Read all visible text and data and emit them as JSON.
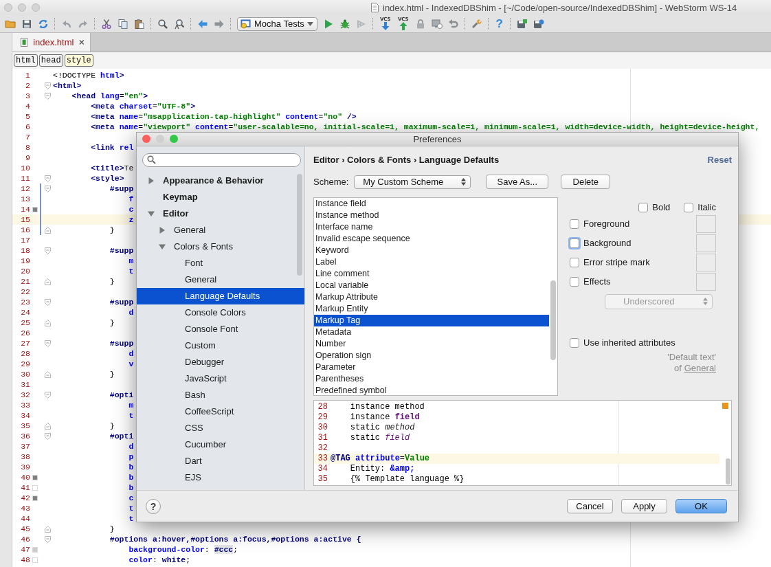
{
  "window": {
    "title": "index.html - IndexedDBShim - [~/Code/open-source/IndexedDBShim] - WebStorm WS-14"
  },
  "toolbar": {
    "run_configuration": "Mocha Tests",
    "vcs_update_label": "VCS",
    "vcs_commit_label": "VCS",
    "help_label": "?"
  },
  "tabs": [
    {
      "label": "index.html",
      "selected": true
    }
  ],
  "breadcrumbs": [
    {
      "label": "html",
      "selected": false
    },
    {
      "label": "head",
      "selected": false
    },
    {
      "label": "style",
      "selected": true
    }
  ],
  "editor": {
    "lines": [
      {
        "number": "1",
        "text": "<!DOCTYPE html>"
      },
      {
        "number": "2",
        "text": "<html>",
        "fold_start": true
      },
      {
        "number": "3",
        "text": "    <head lang=\"en\">",
        "fold_start": true
      },
      {
        "number": "4",
        "text": "        <meta charset=\"UTF-8\">"
      },
      {
        "number": "5",
        "text": "        <meta name=\"msapplication-tap-highlight\" content=\"no\" />"
      },
      {
        "number": "6",
        "text": "        <meta name=\"viewport\" content=\"user-scalable=no, initial-scale=1, maximum-scale=1, minimum-scale=1, width=device-width, height=device-height,"
      },
      {
        "number": "7"
      },
      {
        "number": "8",
        "text": "        <link rel"
      },
      {
        "number": "9"
      },
      {
        "number": "10",
        "text": "        <title>Te"
      },
      {
        "number": "11",
        "text": "        <style>",
        "fold_start": true
      },
      {
        "number": "12",
        "text": "            #supp",
        "fold_start": true,
        "changed": true
      },
      {
        "number": "13",
        "text": "                f",
        "changed": true
      },
      {
        "number": "14",
        "text": "                c",
        "changed": true,
        "color": "#808080"
      },
      {
        "number": "15",
        "text": "                z",
        "changed": true,
        "current": true
      },
      {
        "number": "16",
        "text": "            }",
        "fold_end": true,
        "changed": true
      },
      {
        "number": "17"
      },
      {
        "number": "18",
        "text": "            #supp",
        "fold_start": true
      },
      {
        "number": "19",
        "text": "                m"
      },
      {
        "number": "20",
        "text": "                t"
      },
      {
        "number": "21",
        "text": "            }",
        "fold_end": true
      },
      {
        "number": "22"
      },
      {
        "number": "23",
        "text": "            #supp",
        "fold_start": true
      },
      {
        "number": "24",
        "text": "                d"
      },
      {
        "number": "25",
        "text": "            }",
        "fold_end": true
      },
      {
        "number": "26"
      },
      {
        "number": "27",
        "text": "            #supp",
        "fold_start": true
      },
      {
        "number": "28",
        "text": "                d"
      },
      {
        "number": "29",
        "text": "                v"
      },
      {
        "number": "30",
        "text": "            }",
        "fold_end": true
      },
      {
        "number": "31"
      },
      {
        "number": "32",
        "text": "            #opti",
        "fold_start": true
      },
      {
        "number": "33",
        "text": "                m"
      },
      {
        "number": "34",
        "text": "                t"
      },
      {
        "number": "35",
        "text": "            }",
        "fold_end": true
      },
      {
        "number": "36",
        "text": "            #opti",
        "fold_start": true
      },
      {
        "number": "37",
        "text": "                d"
      },
      {
        "number": "38",
        "text": "                p"
      },
      {
        "number": "39",
        "text": "                b"
      },
      {
        "number": "40",
        "text": "                b",
        "color": "#808080"
      },
      {
        "number": "41",
        "text": "                b",
        "color": "#ffffff"
      },
      {
        "number": "42",
        "text": "                c",
        "color": "#808080"
      },
      {
        "number": "43",
        "text": "                t"
      },
      {
        "number": "44",
        "text": "                t"
      },
      {
        "number": "45",
        "text": "            }",
        "fold_end": true
      },
      {
        "number": "46",
        "text": "            #options a:hover,#options a:focus,#options a:active {",
        "fold_start": true
      },
      {
        "number": "47",
        "text": "                background-color: #ccc;",
        "color": "#cccccc"
      },
      {
        "number": "48",
        "text": "                color: white;",
        "color": "#ffffff"
      }
    ]
  },
  "dialog": {
    "title": "Preferences",
    "nav": [
      {
        "label": "Appearance & Behavior",
        "expanded": false,
        "selected": false
      },
      {
        "label": "Keymap",
        "selected": false
      },
      {
        "label": "Editor",
        "expanded": true,
        "selected": false,
        "children": [
          {
            "label": "General",
            "expanded": false,
            "selected": false
          },
          {
            "label": "Colors & Fonts",
            "expanded": true,
            "selected": false,
            "children": [
              {
                "label": "Font",
                "selected": false
              },
              {
                "label": "General",
                "selected": false
              },
              {
                "label": "Language Defaults",
                "selected": true
              },
              {
                "label": "Console Colors",
                "selected": false
              },
              {
                "label": "Console Font",
                "selected": false
              },
              {
                "label": "Custom",
                "selected": false
              },
              {
                "label": "Debugger",
                "selected": false
              },
              {
                "label": "JavaScript",
                "selected": false
              },
              {
                "label": "Bash",
                "selected": false
              },
              {
                "label": "CoffeeScript",
                "selected": false
              },
              {
                "label": "CSS",
                "selected": false
              },
              {
                "label": "Cucumber",
                "selected": false
              },
              {
                "label": "Dart",
                "selected": false
              },
              {
                "label": "EJS",
                "selected": false
              }
            ]
          }
        ]
      }
    ],
    "path": "Editor › Colors & Fonts › Language Defaults",
    "reset": "Reset",
    "scheme": {
      "label": "Scheme:",
      "value": "My Custom Scheme"
    },
    "scheme_buttons": [
      "Save As...",
      "Delete"
    ],
    "elements": [
      {
        "label": "Instance field",
        "selected": false
      },
      {
        "label": "Instance method",
        "selected": false
      },
      {
        "label": "Interface name",
        "selected": false
      },
      {
        "label": "Invalid escape sequence",
        "selected": false
      },
      {
        "label": "Keyword",
        "selected": false
      },
      {
        "label": "Label",
        "selected": false
      },
      {
        "label": "Line comment",
        "selected": false
      },
      {
        "label": "Local variable",
        "selected": false
      },
      {
        "label": "Markup Attribute",
        "selected": false
      },
      {
        "label": "Markup Entity",
        "selected": false
      },
      {
        "label": "Markup Tag",
        "selected": true
      },
      {
        "label": "Metadata",
        "selected": false
      },
      {
        "label": "Number",
        "selected": false
      },
      {
        "label": "Operation sign",
        "selected": false
      },
      {
        "label": "Parameter",
        "selected": false
      },
      {
        "label": "Parentheses",
        "selected": false
      },
      {
        "label": "Predefined symbol",
        "selected": false
      }
    ],
    "font_styles": [
      {
        "label": "Bold",
        "checked": false
      },
      {
        "label": "Italic",
        "checked": false
      }
    ],
    "attributes": [
      {
        "label": "Foreground",
        "checked": false,
        "focused": false
      },
      {
        "label": "Background",
        "checked": false,
        "focused": true
      },
      {
        "label": "Error stripe mark",
        "checked": false,
        "focused": false
      },
      {
        "label": "Effects",
        "checked": false,
        "focused": false
      }
    ],
    "effect_type": {
      "value": "Underscored",
      "disabled": true
    },
    "inherit": {
      "label": "Use inherited attributes",
      "checked": false
    },
    "inherit_note": "'Default text'",
    "inherit_source": {
      "prefix": "of",
      "link": "General"
    },
    "preview": {
      "lines": [
        {
          "number": "28",
          "segments": [
            {
              "text": "    instance method",
              "kind": "plain"
            }
          ]
        },
        {
          "number": "29",
          "segments": [
            {
              "text": "    instance ",
              "kind": "plain"
            },
            {
              "text": "field",
              "kind": "field"
            }
          ]
        },
        {
          "number": "30",
          "segments": [
            {
              "text": "    static ",
              "kind": "plain"
            },
            {
              "text": "method",
              "kind": "italic"
            }
          ]
        },
        {
          "number": "31",
          "segments": [
            {
              "text": "    static ",
              "kind": "plain"
            },
            {
              "text": "field",
              "kind": "field-italic"
            }
          ]
        },
        {
          "number": "32"
        },
        {
          "number": "33",
          "current": true,
          "segments": [
            {
              "text": "@TAG ",
              "kind": "tag"
            },
            {
              "text": "attribute",
              "kind": "attr"
            },
            {
              "text": "=",
              "kind": "plain"
            },
            {
              "text": "Value",
              "kind": "value"
            }
          ]
        },
        {
          "number": "34",
          "segments": [
            {
              "text": "    Entity: ",
              "kind": "plain"
            },
            {
              "text": "&amp;",
              "kind": "entity"
            }
          ]
        },
        {
          "number": "35",
          "segments": [
            {
              "text": "    {% Template language %}",
              "kind": "plain"
            }
          ]
        }
      ]
    },
    "help_label": "?",
    "buttons": [
      {
        "label": "Cancel",
        "default": false
      },
      {
        "label": "Apply",
        "default": false
      },
      {
        "label": "OK",
        "default": true
      }
    ]
  }
}
